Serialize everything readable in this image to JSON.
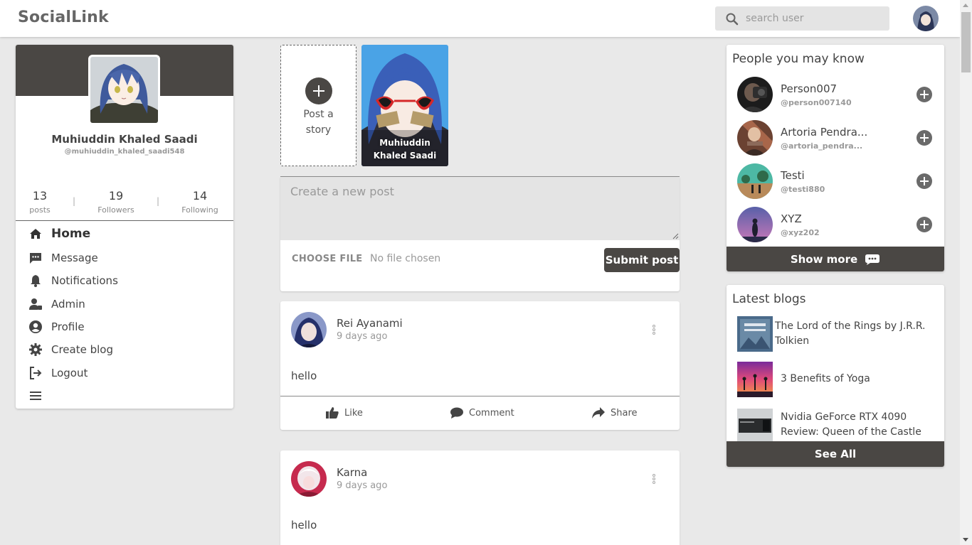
{
  "header": {
    "brand": "SocialLink",
    "search_placeholder": "search user"
  },
  "profile": {
    "name": "Muhiuddin Khaled Saadi",
    "handle": "@muhiuddin_khaled_saadi548",
    "stats": [
      {
        "value": "13",
        "label": "posts"
      },
      {
        "value": "19",
        "label": "Followers"
      },
      {
        "value": "14",
        "label": "Following"
      }
    ],
    "stat_separator": "|"
  },
  "nav": [
    {
      "label": "Home",
      "icon": "home-icon",
      "active": true
    },
    {
      "label": "Message",
      "icon": "message-icon"
    },
    {
      "label": "Notifications",
      "icon": "bell-icon"
    },
    {
      "label": "Admin",
      "icon": "admin-icon"
    },
    {
      "label": "Profile",
      "icon": "profile-icon"
    },
    {
      "label": "Create blog",
      "icon": "gear-icon"
    },
    {
      "label": "Logout",
      "icon": "logout-icon"
    },
    {
      "label": "",
      "icon": "menu-icon"
    }
  ],
  "stories": {
    "add_label": "Post a story",
    "items": [
      {
        "name": "Muhiuddin Khaled Saadi"
      }
    ]
  },
  "composer": {
    "placeholder": "Create a new post",
    "choose_file": "CHOOSE FILE",
    "no_file": "No file chosen",
    "submit": "Submit post"
  },
  "posts": [
    {
      "author": "Rei Ayanami",
      "time": "9 days ago",
      "text": "hello"
    },
    {
      "author": "Karna",
      "time": "9 days ago",
      "text": "hello"
    }
  ],
  "post_actions": {
    "like": "Like",
    "comment": "Comment",
    "share": "Share"
  },
  "people": {
    "title": "People you may know",
    "items": [
      {
        "name": "Person007",
        "handle": "@person007140"
      },
      {
        "name": "Artoria Pendra...",
        "handle": "@artoria_pendra..."
      },
      {
        "name": "Testi",
        "handle": "@testi880"
      },
      {
        "name": "XYZ",
        "handle": "@xyz202"
      }
    ],
    "show_more": "Show more"
  },
  "blogs": {
    "title": "Latest blogs",
    "items": [
      {
        "title": "The Lord of the Rings by J.R.R. Tolkien"
      },
      {
        "title": "3 Benefits of Yoga"
      },
      {
        "title": "Nvidia GeForce RTX 4090 Review: Queen of the Castle"
      }
    ],
    "see_all": "See All"
  },
  "colors": {
    "primary_dark": "#4a4744",
    "background": "#e9e9e9",
    "input_bg": "#e4e4e4"
  }
}
